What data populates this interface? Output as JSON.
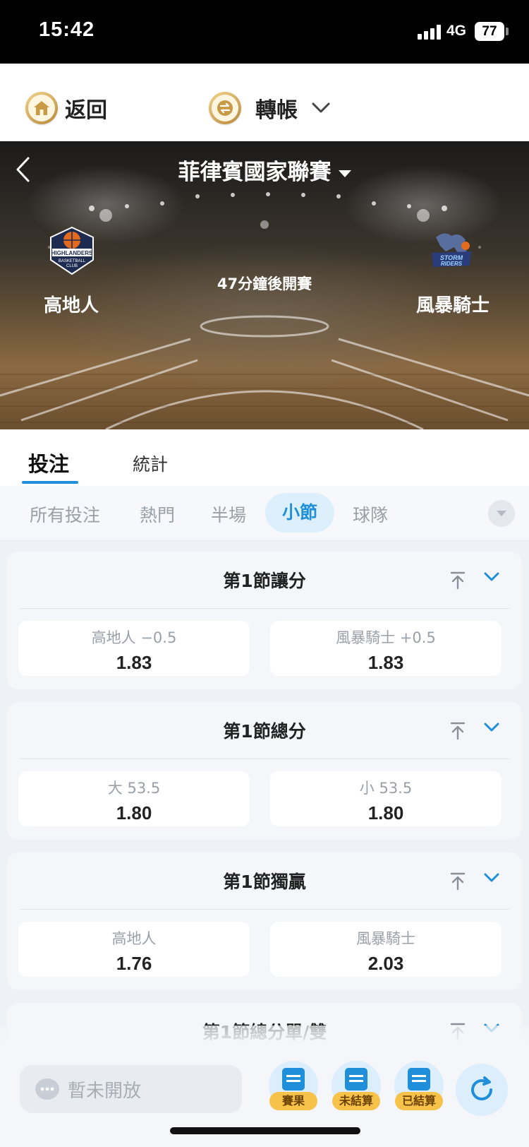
{
  "status_bar": {
    "time": "15:42",
    "network": "4G",
    "battery": "77"
  },
  "top_nav": {
    "back_label": "返回",
    "transfer_label": "轉帳"
  },
  "match": {
    "league": "菲律賓國家聯賽",
    "home_team": "高地人",
    "away_team": "風暴騎士",
    "kickoff_text": "47分鐘後開賽",
    "home_logo_text": [
      "HIGHLANDERS",
      "BASKETBALL",
      "CLUB"
    ],
    "away_logo_text": [
      "STORM",
      "RIDERS"
    ]
  },
  "main_tabs": [
    "投注",
    "統計"
  ],
  "sub_tabs": [
    "所有投注",
    "熱門",
    "半場",
    "小節",
    "球隊"
  ],
  "active_sub_tab": "小節",
  "markets": [
    {
      "title": "第1節讓分",
      "options": [
        {
          "label": "高地人 −0.5",
          "odds": "1.83"
        },
        {
          "label": "風暴騎士 +0.5",
          "odds": "1.83"
        }
      ]
    },
    {
      "title": "第1節總分",
      "options": [
        {
          "label": "大 53.5",
          "odds": "1.80"
        },
        {
          "label": "小 53.5",
          "odds": "1.80"
        }
      ]
    },
    {
      "title": "第1節獨贏",
      "options": [
        {
          "label": "高地人",
          "odds": "1.76"
        },
        {
          "label": "風暴騎士",
          "odds": "2.03"
        }
      ]
    },
    {
      "title": "第1節總分單/雙",
      "options": []
    }
  ],
  "bottom_bar": {
    "chat_placeholder": "暫未開放",
    "results_label": "賽果",
    "unsettled_label": "未結算",
    "settled_label": "已結算"
  },
  "colors": {
    "accent_blue": "#1e8fd8",
    "gold": "#c99a45",
    "badge_yellow": "#f6c24a"
  }
}
